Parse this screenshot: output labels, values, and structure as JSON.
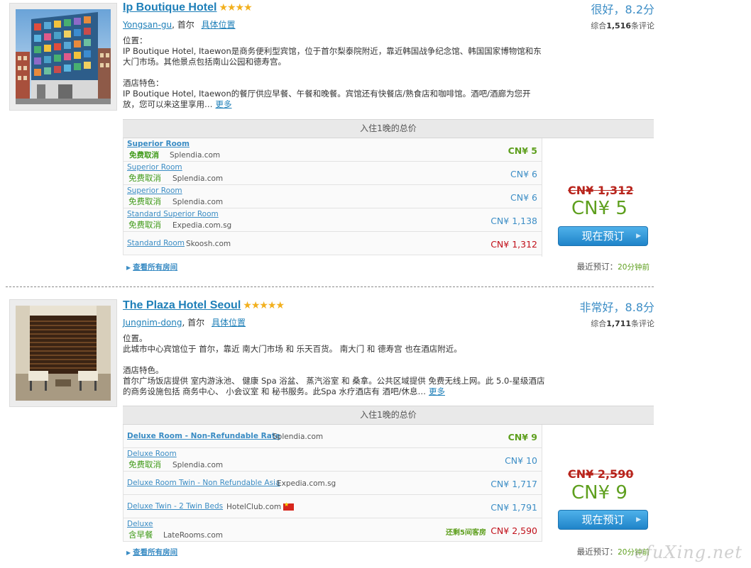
{
  "colors": {
    "link": "#1e7fb8",
    "price_blue": "#3d8ec6",
    "price_green": "#5e9f1e",
    "price_red": "#c1101a",
    "button": "#2b8fd6"
  },
  "hotels": [
    {
      "name": "Ip Boutique Hotel",
      "stars": "★★★★",
      "star_count": 4,
      "area": "Yongsan-gu",
      "city": ", 首尔",
      "map_link": "具体位置",
      "rating_text": "很好，8.2分",
      "review_prefix": "综合",
      "review_count": "1,516",
      "review_suffix": "条评论",
      "location_heading": "位置：",
      "location_text": "IP Boutique Hotel, Itaewon是商务便利型宾馆，位于首尔梨泰院附近，靠近韩国战争纪念馆、韩国国家博物馆和东大门市场。其他景点包括南山公园和德寿宫。",
      "features_heading": "酒店特色：",
      "features_text": "IP Boutique Hotel, Itaewon的餐厅供应早餐、午餐和晚餐。宾馆还有快餐店/熟食店和咖啡馆。酒吧/酒廊为您开放，您可以来这里享用…",
      "more_link": "更多",
      "price_header": "入住1晚的总价",
      "rooms": [
        {
          "name": "Superior Room",
          "cancel": "免费取消",
          "provider": "Splendia.com",
          "price": "CN¥ 5"
        },
        {
          "name": "Superior Room",
          "cancel": "免费取消",
          "provider": "Splendia.com",
          "price": "CN¥ 6"
        },
        {
          "name": "Superior Room",
          "cancel": "免费取消",
          "provider": "Splendia.com",
          "price": "CN¥ 6"
        },
        {
          "name": "Standard Superior Room",
          "cancel": "免费取消",
          "provider": "Expedia.com.sg",
          "price": "CN¥ 1,138"
        },
        {
          "name": "Standard Room",
          "cancel": "",
          "provider": "Skoosh.com",
          "price": "CN¥ 1,312"
        }
      ],
      "old_price_cur": "CN¥",
      "old_price_val": "1,312",
      "best_price": "CN¥ 5",
      "book_label": "现在预订",
      "all_rooms_label": "查看所有房间",
      "recent_label": "最近预订：",
      "recent_ago": "20分钟前"
    },
    {
      "name": "The Plaza Hotel Seoul",
      "stars": "★★★★★",
      "star_count": 5,
      "area": "Jungnim-dong",
      "city": ", 首尔",
      "map_link": "具体位置",
      "rating_text": "非常好，8.8分",
      "review_prefix": "综合",
      "review_count": "1,711",
      "review_suffix": "条评论",
      "location_heading": "位置。",
      "location_text": "此城市中心宾馆位于 首尔，靠近 南大门市场 和 乐天百货。 南大门 和 德寿宫 也在酒店附近。",
      "features_heading": "酒店特色。",
      "features_text": "首尔广场饭店提供 室内游泳池、 健康 Spa 浴盆、 蒸汽浴室 和 桑拿。公共区域提供 免费无线上网。此 5.0-星级酒店的商务设施包括 商务中心、 小会议室 和 秘书服务。此Spa 水疗酒店有 酒吧/休息…",
      "more_link": "更多",
      "price_header": "入住1晚的总价",
      "rooms": [
        {
          "name": "Deluxe Room - Non-Refundable Rate",
          "cancel": "",
          "provider": "Splendia.com",
          "price": "CN¥ 9"
        },
        {
          "name": "Deluxe Room",
          "cancel": "免费取消",
          "provider": "Splendia.com",
          "price": "CN¥ 10"
        },
        {
          "name": "Deluxe Room Twin - Non Refundable Asia",
          "cancel": "",
          "provider": "Expedia.com.sg",
          "price": "CN¥ 1,717"
        },
        {
          "name": "Deluxe Twin - 2 Twin Beds",
          "cancel": "",
          "provider": "HotelClub.com",
          "price": "CN¥ 1,791"
        },
        {
          "name": "Deluxe",
          "cancel": "含早餐",
          "provider": "LateRooms.com",
          "price": "CN¥ 2,590",
          "availability": "还剩5间客房"
        }
      ],
      "old_price_cur": "CN¥",
      "old_price_val": "2,590",
      "best_price": "CN¥ 9",
      "book_label": "现在预订",
      "all_rooms_label": "查看所有房间",
      "recent_label": "最近预订：",
      "recent_ago": "20分钟前"
    }
  ],
  "watermark": "efuXing.net"
}
